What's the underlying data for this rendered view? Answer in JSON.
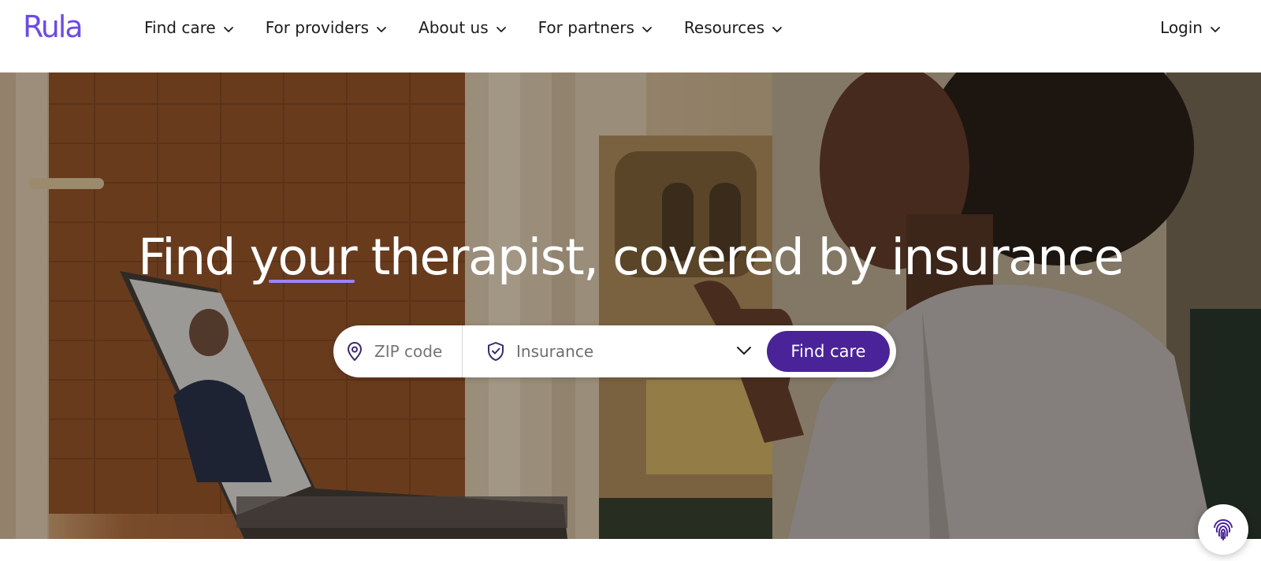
{
  "brand": {
    "logo_text": "Rula",
    "accent_color": "#6c4ce3",
    "button_color": "#4a2399"
  },
  "nav": {
    "items": [
      {
        "label": "Find care",
        "icon": "chevron-down-icon"
      },
      {
        "label": "For providers",
        "icon": "chevron-down-icon"
      },
      {
        "label": "About us",
        "icon": "chevron-down-icon"
      },
      {
        "label": "For partners",
        "icon": "chevron-down-icon"
      },
      {
        "label": "Resources",
        "icon": "chevron-down-icon"
      }
    ],
    "login": {
      "label": "Login",
      "icon": "chevron-down-icon"
    }
  },
  "hero": {
    "headline_prefix": "Find ",
    "headline_accent": "your",
    "headline_suffix": " therapist, covered by insurance",
    "search": {
      "zip_placeholder": "ZIP code",
      "zip_icon": "location-pin-icon",
      "insurance_placeholder": "Insurance",
      "insurance_icon": "shield-check-icon",
      "dropdown_icon": "chevron-down-icon",
      "submit_label": "Find care"
    }
  },
  "badge": {
    "icon": "fingerprint-icon"
  }
}
